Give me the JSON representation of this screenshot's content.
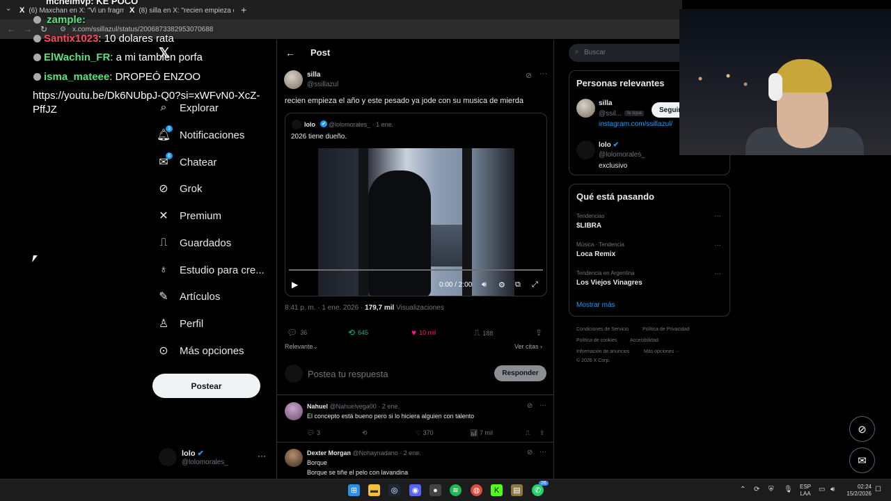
{
  "browser": {
    "tabs": [
      {
        "label": "(6) Maxchan en X: \"Vi un fragm",
        "close": "✕"
      },
      {
        "label": "(8) silla en X: \"recien empieza el",
        "close": "✕"
      }
    ],
    "new_tab": "+",
    "url": "x.com/ssillazul/status/2006873382953070688"
  },
  "chat": {
    "lines": [
      {
        "user": "Santix1023",
        "msg": ": 10 dolares rata"
      },
      {
        "user": "ElWachin_FR",
        "msg": ": a mi tambien porfa"
      },
      {
        "user": "isma_mateee",
        "msg": ": DROPEÓ ENZOO"
      }
    ],
    "top_fragment": "zample:",
    "top_fragment2": "mchelmvp: KE POCO",
    "link": "https://youtu.be/Dk6NUbpJ-Q0?si=xWFvN0-XcZ-PffJZ"
  },
  "nav": {
    "items": [
      {
        "label": "Explorar",
        "icon": "search-icon"
      },
      {
        "label": "Notificaciones",
        "icon": "bell-icon",
        "badge": "3"
      },
      {
        "label": "Chatear",
        "icon": "mail-icon",
        "badge": "6"
      },
      {
        "label": "Grok",
        "icon": "grok-icon"
      },
      {
        "label": "Premium",
        "icon": "x-icon"
      },
      {
        "label": "Guardados",
        "icon": "bookmark-icon"
      },
      {
        "label": "Estudio para cre...",
        "icon": "flask-icon"
      },
      {
        "label": "Artículos",
        "icon": "article-icon"
      },
      {
        "label": "Perfil",
        "icon": "person-icon"
      },
      {
        "label": "Más opciones",
        "icon": "more-circle-icon"
      }
    ],
    "post_button": "Postear",
    "account": {
      "name": "lolo",
      "handle": "@lolomorales_",
      "more": "···"
    }
  },
  "post": {
    "header": "Post",
    "author": {
      "name": "silla",
      "handle": "@ssillazul"
    },
    "text": "recien empieza el año y este pesado ya jode con su musica de mierda",
    "quote": {
      "name": "lolo",
      "handle": "@lolomorales_ · 1 ene.",
      "text": "2026 tiene dueño.",
      "video_time": "0:00 / 2:00",
      "video_progress": 0
    },
    "meta_time": "8:41 p. m. · 1 ene. 2026 · ",
    "meta_views": "179,7 mil",
    "meta_views_label": " Visualizaciones",
    "stats": {
      "replies": "36",
      "reposts": "645",
      "likes": "10 mil",
      "bookmarks": "188"
    },
    "sort": "Relevante",
    "view_quotes": "Ver citas",
    "reply_placeholder": "Postea tu respuesta",
    "reply_button": "Responder"
  },
  "replies": [
    {
      "name": "Nahuel",
      "handle": "@Nahuelvega00 · 2 ene.",
      "text": "El concepto está bueno pero si lo hiciera alguien con talento",
      "replies": "3",
      "likes": "370",
      "views": "7 mil"
    },
    {
      "name": "Dexter Morgan",
      "handle": "@Nohaynadano · 2 ene.",
      "text1": "Borque",
      "text2": "Borque se tiñe el pelo con lavandina"
    }
  ],
  "right": {
    "search_placeholder": "Buscar",
    "relevant_title": "Personas relevantes",
    "relevant": [
      {
        "name": "silla",
        "handle": "@ssil...",
        "follows_you": "Te sigue",
        "follow": "Seguir",
        "link": "instagram.com/ssillazul/"
      },
      {
        "name": "lolo",
        "handle": "@lolomorales_",
        "bio": "exclusivo"
      }
    ],
    "trends_title": "Qué está pasando",
    "trends": [
      {
        "category": "Tendencias",
        "name": "$LIBRA"
      },
      {
        "category": "Música · Tendencia",
        "name": "Loca Remix"
      },
      {
        "category": "Tendencia en Argentina",
        "name": "Los Viejos Vinagres"
      }
    ],
    "show_more": "Mostrar más",
    "footer": {
      "l1a": "Condiciones de Servicio",
      "l1b": "Política de Privacidad",
      "l2a": "Política de cookies",
      "l2b": "Accesibilidad",
      "l3a": "Información de anuncios",
      "l3b": "Más opciones ···",
      "copy": "© 2026 X Corp."
    }
  },
  "taskbar": {
    "lang1": "ESP",
    "lang2": "LAA",
    "time": "02:24",
    "date": "15/2/2026",
    "whatsapp_badge": "26"
  },
  "colors": {
    "accent": "#1d9bf0",
    "like": "#f91880",
    "repost": "#00ba7c"
  }
}
